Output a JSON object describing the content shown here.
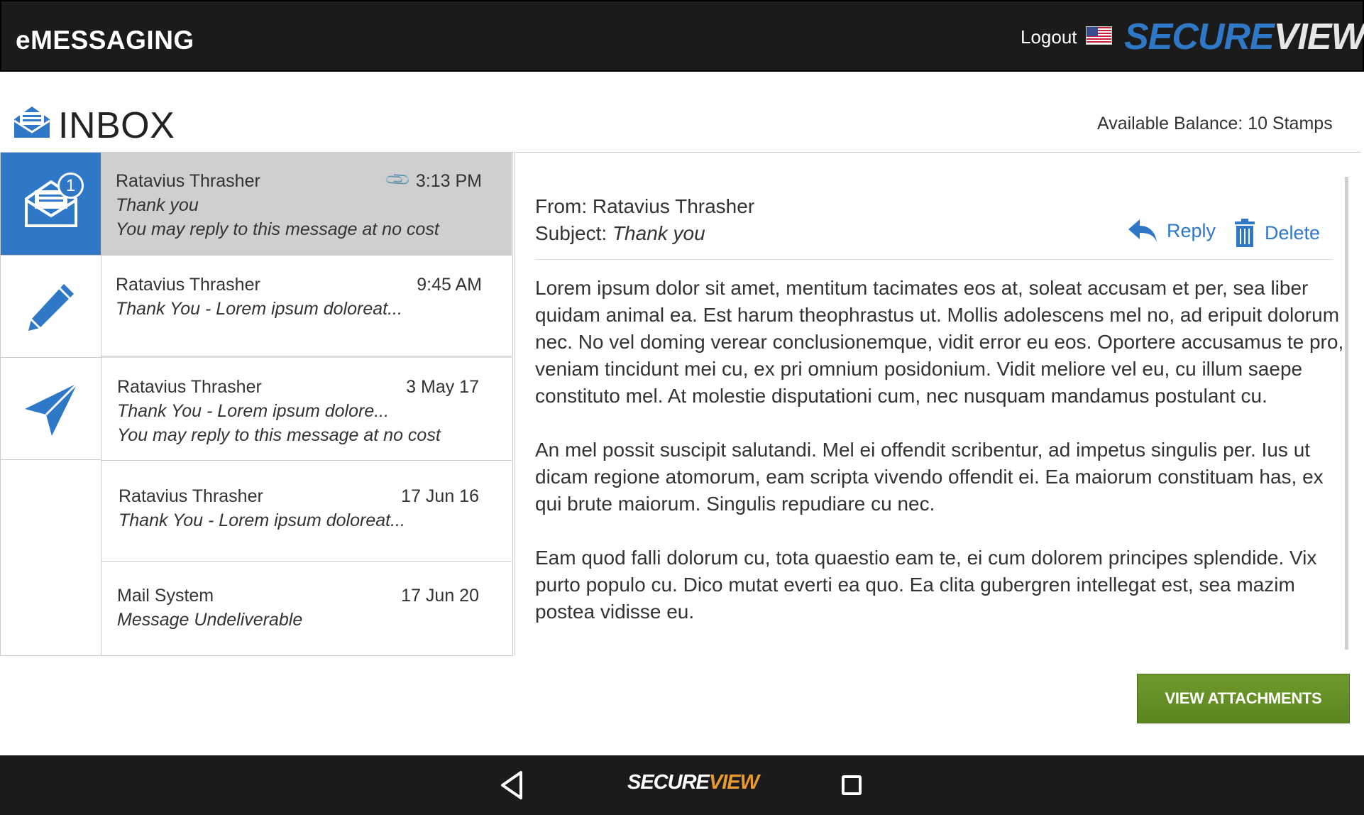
{
  "header": {
    "app_title": "eMESSAGING",
    "logout_label": "Logout",
    "brand_part1": "SECURE",
    "brand_part2": "VIEW"
  },
  "inbox": {
    "title": "INBOX",
    "balance": "Available Balance: 10 Stamps",
    "unread_badge": "1"
  },
  "messages": [
    {
      "sender": "Ratavius Thrasher",
      "time": "3:13 PM",
      "line1": "Thank you",
      "line2": "You may reply to this message at no cost",
      "attachment": true,
      "selected": true
    },
    {
      "sender": "Ratavius Thrasher",
      "time": "9:45 AM",
      "line1": "Thank You - Lorem ipsum doloreat...",
      "line2": ""
    },
    {
      "sender": "Ratavius Thrasher",
      "time": "3 May 17",
      "line1": "Thank You - Lorem ipsum dolore...",
      "line2": "You may reply to this message at no cost"
    },
    {
      "sender": "Ratavius Thrasher",
      "time": "17 Jun 16",
      "line1": "Thank You - Lorem ipsum doloreat...",
      "line2": ""
    },
    {
      "sender": "Mail System",
      "time": "17 Jun 20",
      "line1": "Message Undeliverable",
      "line2": ""
    }
  ],
  "reader": {
    "from_label": "From:",
    "from_value": "Ratavius Thrasher",
    "subject_label": "Subject:",
    "subject_value": "Thank you",
    "reply_label": "Reply",
    "delete_label": "Delete",
    "paragraphs": [
      "Lorem ipsum dolor sit amet, mentitum tacimates eos at, soleat accusam et per, sea liber quidam animal ea. Est harum theophrastus ut. Mollis adolescens mel no, ad eripuit dolorum nec. No vel doming verear conclusionemque, vidit error eu eos. Oportere accusamus te pro, veniam tincidunt mei cu, ex pri omnium posidonium. Vidit meliore vel eu, cu illum saepe constituto mel. At molestie disputationi cum, nec nusquam mandamus postulant cu.",
      "An mel possit suscipit salutandi. Mel ei offendit scribentur, ad impetus singulis per. Ius ut dicam regione atomorum, eam scripta vivendo offendit ei. Ea maiorum constituam has, ex qui brute maiorum. Singulis repudiare cu nec.",
      "Eam quod falli dolorum cu, tota quaestio eam te, ei cum dolorem principes splendide. Vix purto populo cu. Dico mutat everti ea quo. Ea clita gubergren intellegat est, sea mazim postea vidisse eu."
    ]
  },
  "actions": {
    "view_attachments_label": "VIEW ATTACHMENTS"
  },
  "navbar": {
    "logo_part1": "SECURE",
    "logo_part2": "VIEW"
  },
  "colors": {
    "accent": "#2f78c8",
    "topbar": "#1b1b1b",
    "button_green": "#5b8420",
    "nav_logo_orange": "#e89a2e"
  }
}
